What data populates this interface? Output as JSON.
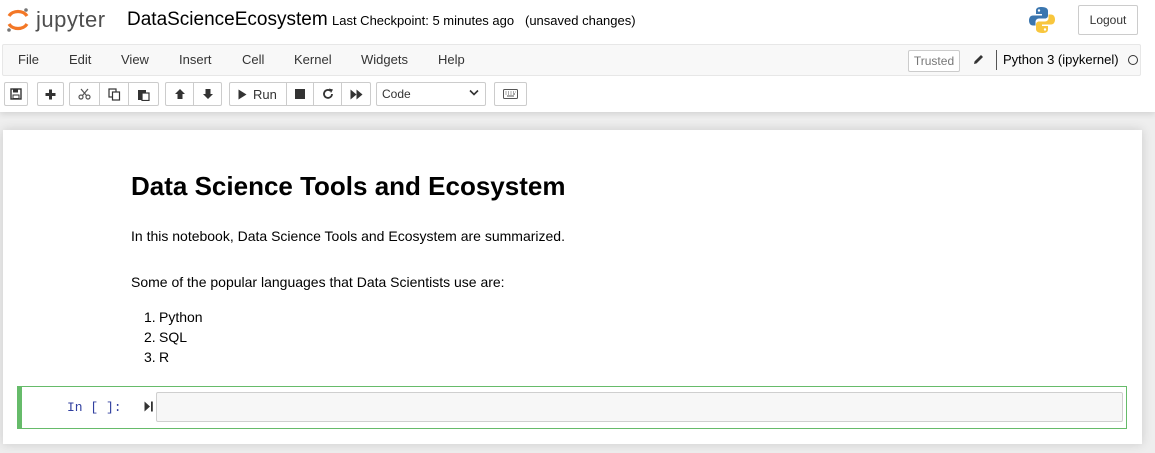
{
  "header": {
    "logo_text": "jupyter",
    "notebook_name": "DataScienceEcosystem",
    "checkpoint": "Last Checkpoint: 5 minutes ago",
    "unsaved": "(unsaved changes)",
    "logout_label": "Logout"
  },
  "menubar": {
    "items": [
      "File",
      "Edit",
      "View",
      "Insert",
      "Cell",
      "Kernel",
      "Widgets",
      "Help"
    ],
    "trusted_label": "Trusted",
    "kernel_name": "Python 3 (ipykernel)"
  },
  "toolbar": {
    "run_label": "Run",
    "cell_type": "Code",
    "icons": [
      "save-icon",
      "plus-icon",
      "cut-icon",
      "copy-icon",
      "paste-icon",
      "arrow-up-icon",
      "arrow-down-icon",
      "play-icon",
      "stop-icon",
      "restart-icon",
      "fast-forward-icon",
      "keyboard-icon"
    ]
  },
  "notebook": {
    "title": "Data Science Tools and Ecosystem",
    "intro": "In this notebook, Data Science Tools and Ecosystem are summarized.",
    "languages_intro": "Some of the popular languages that Data Scientists use are:",
    "languages": [
      "Python",
      "SQL",
      "R"
    ],
    "code_prompt": "In [ ]:"
  },
  "colors": {
    "jupyter_orange": "#f37726",
    "selected_cell_border": "#66bb6a",
    "prompt_blue": "#303f9f"
  }
}
